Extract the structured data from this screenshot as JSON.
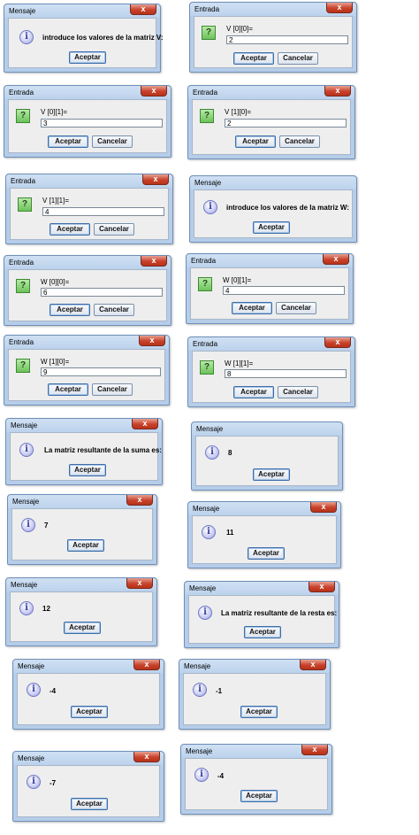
{
  "mensaje_title": "Mensaje",
  "entrada_title": "Entrada",
  "close_glyph": "x",
  "ok_label": "Aceptar",
  "cancel_label": "Cancelar",
  "messages": {
    "intro_v": "introduce los valores de la matriz V:",
    "intro_w": "introduce los valores de la matriz W:",
    "suma": "La matriz resultante de la suma es:",
    "sum_0": "8",
    "sum_1": "7",
    "sum_2": "11",
    "sum_3": "12",
    "resta": "La matriz resultante de la resta es:",
    "diff_0": "-4",
    "diff_1": "-1",
    "diff_2": "-7",
    "diff_3": "-4"
  },
  "inputs": {
    "v00": {
      "prompt": "V [0][0]=",
      "value": "2"
    },
    "v01": {
      "prompt": "V [0][1]=",
      "value": "3"
    },
    "v10": {
      "prompt": "V [1][0]=",
      "value": "2"
    },
    "v11": {
      "prompt": "V [1][1]=",
      "value": "4"
    },
    "w00": {
      "prompt": "W [0][0]=",
      "value": "6"
    },
    "w01": {
      "prompt": "W [0][1]=",
      "value": "4"
    },
    "w10": {
      "prompt": "W [1][0]=",
      "value": "9"
    },
    "w11": {
      "prompt": "W [1][1]=",
      "value": "8"
    }
  },
  "icons": {
    "info": "information-icon",
    "question": "question-icon",
    "close": "close-icon"
  }
}
